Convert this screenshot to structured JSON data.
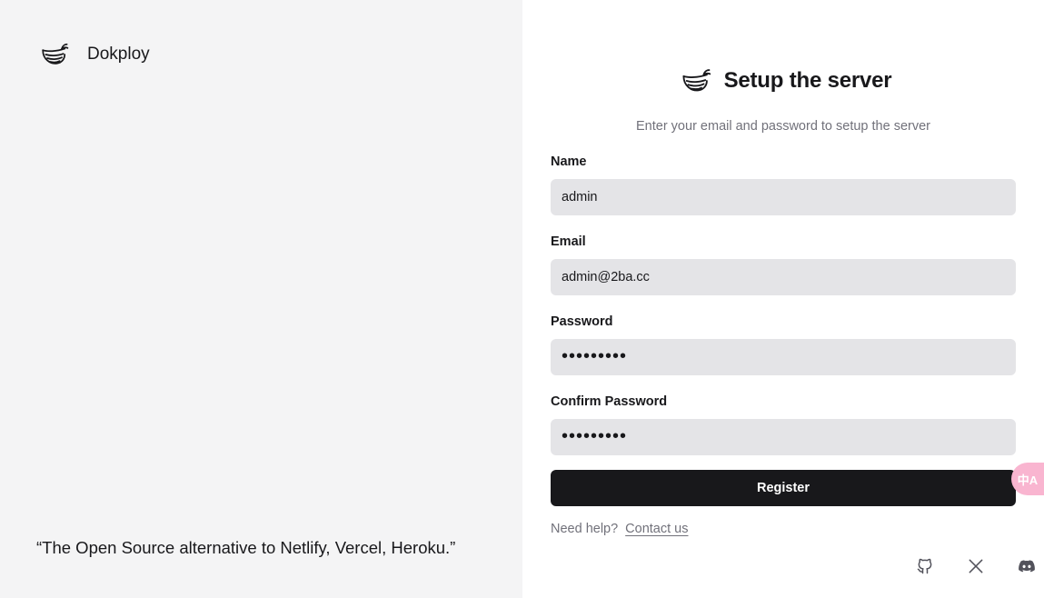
{
  "brand": {
    "name": "Dokploy",
    "logo_icon": "whale-icon"
  },
  "quote": {
    "text": "“The Open Source alternative to Netlify, Vercel, Heroku.”"
  },
  "setup": {
    "title": "Setup the server",
    "subtitle": "Enter your email and password to setup the server"
  },
  "form": {
    "name": {
      "label": "Name",
      "value": "admin"
    },
    "email": {
      "label": "Email",
      "value": "admin@2ba.cc"
    },
    "password": {
      "label": "Password",
      "value": "•••••••••"
    },
    "confirm_password": {
      "label": "Confirm Password",
      "value": "•••••••••"
    },
    "register_label": "Register"
  },
  "help": {
    "text": "Need help?",
    "link": "Contact us"
  },
  "socials": [
    {
      "icon": "github-icon"
    },
    {
      "icon": "x-icon"
    },
    {
      "icon": "discord-icon"
    }
  ],
  "translate_widget": {
    "icon": "translate-icon",
    "glyph": "中A"
  },
  "colors": {
    "left_bg": "#f4f4f5",
    "input_bg": "#e4e4e7",
    "button_bg": "#18181b",
    "muted_text": "#71717a",
    "translate_bg": "#f9b5d0"
  }
}
